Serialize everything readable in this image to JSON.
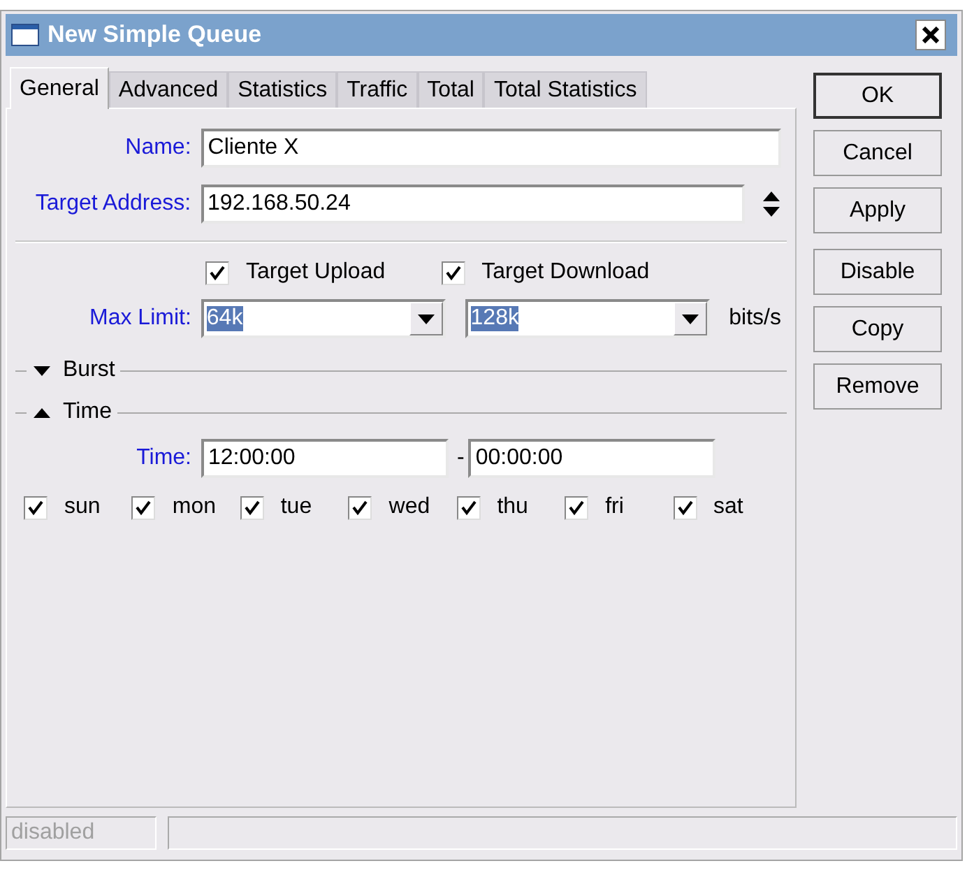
{
  "window": {
    "title": "New Simple Queue"
  },
  "tabs": [
    {
      "label": "General",
      "selected": true
    },
    {
      "label": "Advanced",
      "selected": false
    },
    {
      "label": "Statistics",
      "selected": false
    },
    {
      "label": "Traffic",
      "selected": false
    },
    {
      "label": "Total",
      "selected": false
    },
    {
      "label": "Total Statistics",
      "selected": false
    }
  ],
  "name": {
    "label": "Name:",
    "value": "Cliente X"
  },
  "target_address": {
    "label": "Target Address:",
    "value": "192.168.50.24"
  },
  "targets": [
    {
      "label": "Target Upload",
      "checked": true
    },
    {
      "label": "Target Download",
      "checked": true
    }
  ],
  "max_limit": {
    "label": "Max Limit:",
    "unit": "bits/s",
    "values": [
      {
        "value": "64k",
        "text_selected": true
      },
      {
        "value": "128k",
        "text_selected": true
      }
    ]
  },
  "sections": [
    {
      "label": "Burst",
      "expanded": false
    },
    {
      "label": "Time",
      "expanded": true
    }
  ],
  "time": {
    "label": "Time:",
    "start": "12:00:00",
    "separator": "-",
    "end": "00:00:00"
  },
  "days": [
    {
      "label": "sun",
      "checked": true
    },
    {
      "label": "mon",
      "checked": true
    },
    {
      "label": "tue",
      "checked": true
    },
    {
      "label": "wed",
      "checked": true
    },
    {
      "label": "thu",
      "checked": true
    },
    {
      "label": "fri",
      "checked": true
    },
    {
      "label": "sat",
      "checked": true
    }
  ],
  "button_groups": [
    [
      {
        "label": "OK",
        "default": true
      },
      {
        "label": "Cancel",
        "default": false
      },
      {
        "label": "Apply",
        "default": false
      }
    ],
    [
      {
        "label": "Disable",
        "default": false
      },
      {
        "label": "Copy",
        "default": false
      },
      {
        "label": "Remove",
        "default": false
      }
    ]
  ],
  "status_bar": {
    "state": "disabled"
  }
}
